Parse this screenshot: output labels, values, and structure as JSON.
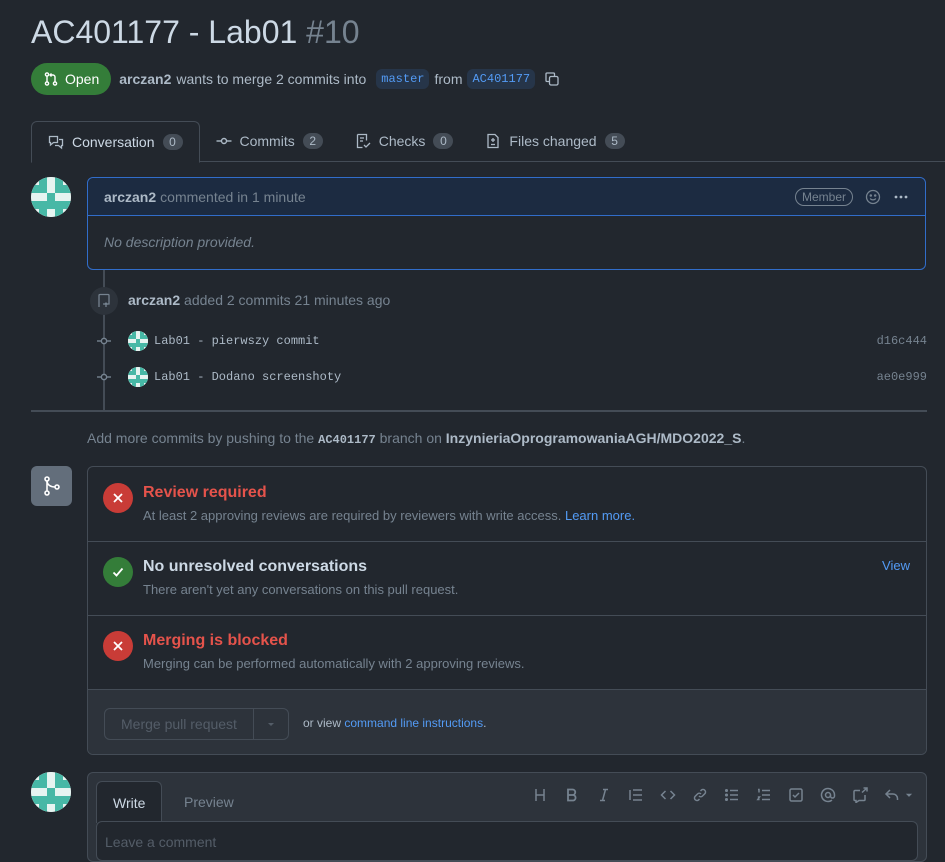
{
  "pr": {
    "title": "AC401177 - Lab01",
    "number": "#10"
  },
  "meta": {
    "state": "Open",
    "author": "arczan2",
    "text_merge": "wants to merge 2 commits into",
    "base_branch": "master",
    "text_from": "from",
    "head_branch": "AC401177"
  },
  "tabs": [
    {
      "label": "Conversation",
      "count": "0"
    },
    {
      "label": "Commits",
      "count": "2"
    },
    {
      "label": "Checks",
      "count": "0"
    },
    {
      "label": "Files changed",
      "count": "5"
    }
  ],
  "comment": {
    "author": "arczan2",
    "timestamp": "commented in 1 minute",
    "role": "Member",
    "body": "No description provided."
  },
  "timeline": {
    "author": "arczan2",
    "text": "added 2 commits 21 minutes ago",
    "commits": [
      {
        "message": "Lab01 - pierwszy commit",
        "sha": "d16c444"
      },
      {
        "message": "Lab01 - Dodano screenshoty",
        "sha": "ae0e999"
      }
    ]
  },
  "hint": {
    "prefix": "Add more commits by pushing to the",
    "branch": "AC401177",
    "middle": "branch on",
    "repo": "InzynieriaOprogramowaniaAGH/MDO2022_S",
    "suffix": "."
  },
  "merge": {
    "review": {
      "title": "Review required",
      "desc": "At least 2 approving reviews are required by reviewers with write access.",
      "link": "Learn more."
    },
    "conversations": {
      "title": "No unresolved conversations",
      "desc": "There aren't yet any conversations on this pull request.",
      "link": "View"
    },
    "blocked": {
      "title": "Merging is blocked",
      "desc": "Merging can be performed automatically with 2 approving reviews."
    },
    "button": "Merge pull request",
    "or_view": "or view",
    "cli_link": "command line instructions",
    "cli_suffix": "."
  },
  "editor": {
    "write_tab": "Write",
    "preview_tab": "Preview",
    "placeholder": "Leave a comment"
  },
  "colors": {
    "open": "#347d39",
    "error": "#c93c37",
    "accent": "#539bf5",
    "background": "#22272e"
  }
}
